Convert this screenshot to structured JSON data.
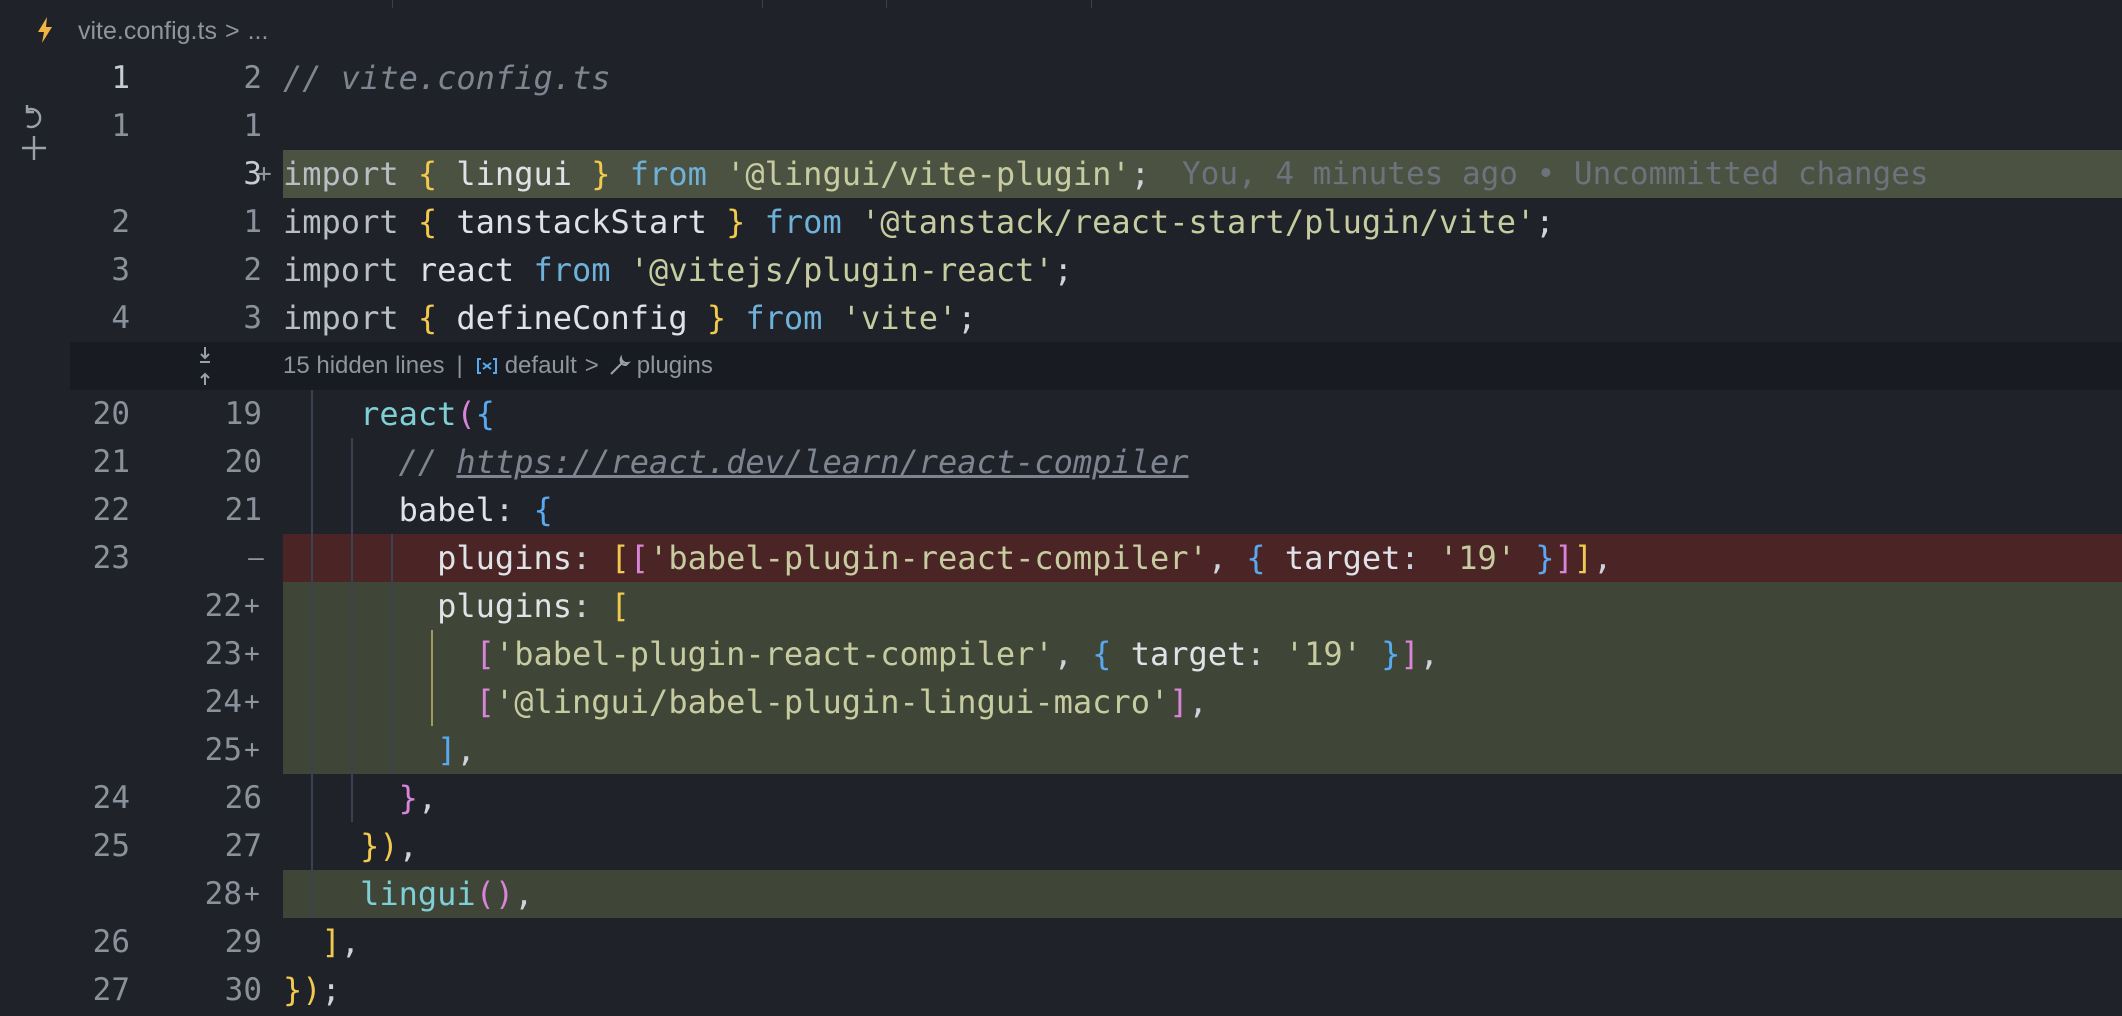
{
  "breadcrumb": {
    "file": "vite.config.ts",
    "separator": ">",
    "ellipsis": "..."
  },
  "colors": {
    "editor_bg": "#1f2229",
    "added_bg": "#3f4637",
    "removed_bg": "#4b2526",
    "string": "#c7cca0",
    "keyword_from": "#6eb1d9",
    "bracket_yellow": "#f0c94e",
    "bracket_pink": "#d884d8",
    "bracket_blue": "#58a9f0"
  },
  "gutter_icons": [
    "revert-change-icon",
    "add-comment-icon"
  ],
  "hidden_region": {
    "label": "15 hidden lines",
    "divider": "|",
    "scope1": "default",
    "chevron": ">",
    "scope2": "plugins"
  },
  "blame": "You, 4 minutes ago • Uncommitted changes",
  "lines": [
    {
      "old": "1",
      "new": "2",
      "marker": "",
      "code": "// vite.config.ts"
    },
    {
      "old": "1",
      "new": "1",
      "marker": "",
      "code": ""
    },
    {
      "old": "",
      "new": "3",
      "marker": "+",
      "code": "import { lingui } from '@lingui/vite-plugin';"
    },
    {
      "old": "2",
      "new": "1",
      "marker": "",
      "code": "import { tanstackStart } from '@tanstack/react-start/plugin/vite';"
    },
    {
      "old": "3",
      "new": "2",
      "marker": "",
      "code": "import react from '@vitejs/plugin-react';"
    },
    {
      "old": "4",
      "new": "3",
      "marker": "",
      "code": "import { defineConfig } from 'vite';"
    },
    {
      "old": "20",
      "new": "19",
      "marker": "",
      "code": "    react({"
    },
    {
      "old": "21",
      "new": "20",
      "marker": "",
      "code": "      // https://react.dev/learn/react-compiler"
    },
    {
      "old": "22",
      "new": "21",
      "marker": "",
      "code": "      babel: {"
    },
    {
      "old": "23",
      "new": "",
      "marker": "—",
      "code": "        plugins: [['babel-plugin-react-compiler', { target: '19' }]],"
    },
    {
      "old": "",
      "new": "22",
      "marker": "+",
      "code": "        plugins: ["
    },
    {
      "old": "",
      "new": "23",
      "marker": "+",
      "code": "          ['babel-plugin-react-compiler', { target: '19' }],"
    },
    {
      "old": "",
      "new": "24",
      "marker": "+",
      "code": "          ['@lingui/babel-plugin-lingui-macro'],"
    },
    {
      "old": "",
      "new": "25",
      "marker": "+",
      "code": "        ],"
    },
    {
      "old": "24",
      "new": "26",
      "marker": "",
      "code": "      },"
    },
    {
      "old": "25",
      "new": "27",
      "marker": "",
      "code": "    }),"
    },
    {
      "old": "",
      "new": "28",
      "marker": "+",
      "code": "    lingui(),"
    },
    {
      "old": "26",
      "new": "29",
      "marker": "",
      "code": "  ],"
    },
    {
      "old": "27",
      "new": "30",
      "marker": "",
      "code": "});"
    }
  ]
}
